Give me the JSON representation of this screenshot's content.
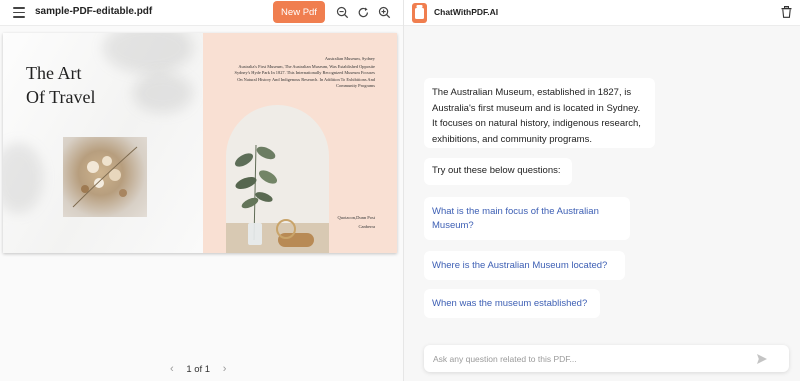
{
  "viewer": {
    "file_name": "sample-PDF-editable.pdf",
    "new_pdf_label": "New Pdf",
    "tools": [
      "zoom-out-icon",
      "rotate-icon",
      "zoom-in-icon"
    ],
    "page_indicator": "1 of 1",
    "prev_arrow": "‹",
    "next_arrow": "›"
  },
  "document": {
    "title_line1": "The Art",
    "title_line2": "Of Travel",
    "heading": "Australian Museum, Sydney",
    "body": "Australia's First Museum, The Australian Museum, Was Established Opposite Sydney's Hyde Park In 1827. This Internationally Recognized Museum Focuses On Natural History And Indigenous Research. In Addition To Exhibitions And Community Programs",
    "footer_line1": "Quotacon,Dunn Post",
    "footer_line2": "Canberra"
  },
  "chat": {
    "app_title": "ChatWithPDF.AI",
    "summary": "The Australian Museum, established in 1827, is Australia's first museum and is located in Sydney. It focuses on natural history, indigenous research, exhibitions, and community programs.",
    "try_out": "Try out these below questions:",
    "questions": [
      "What is the main focus of the Australian Museum?",
      "Where is the Australian Museum located?",
      "When was the museum established?"
    ],
    "input_placeholder": "Ask any question related to this PDF...",
    "accent_color": "#f07e4f",
    "link_color": "#3d5fb4"
  }
}
